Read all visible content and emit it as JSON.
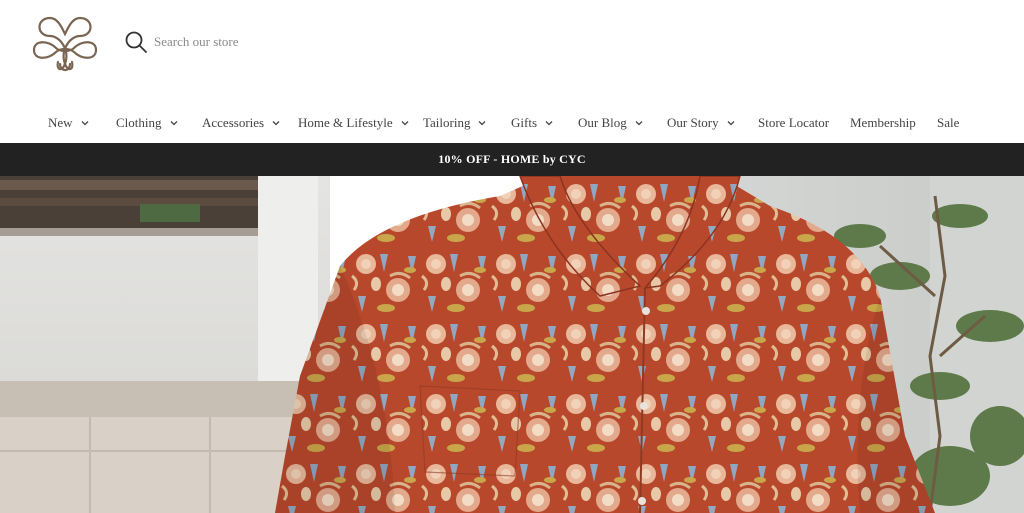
{
  "search": {
    "placeholder": "Search our store"
  },
  "nav": {
    "items": [
      {
        "label": "New",
        "has_dropdown": true
      },
      {
        "label": "Clothing",
        "has_dropdown": true
      },
      {
        "label": "Accessories",
        "has_dropdown": true
      },
      {
        "label": "Home & Lifestyle",
        "has_dropdown": true
      },
      {
        "label": "Tailoring",
        "has_dropdown": true
      },
      {
        "label": "Gifts",
        "has_dropdown": true
      },
      {
        "label": "Our Blog",
        "has_dropdown": true
      },
      {
        "label": "Our Story",
        "has_dropdown": true
      },
      {
        "label": "Store Locator",
        "has_dropdown": false
      },
      {
        "label": "Membership",
        "has_dropdown": false
      },
      {
        "label": "Sale",
        "has_dropdown": false
      }
    ]
  },
  "promo": {
    "text": "10% OFF - HOME by CYC"
  },
  "colors": {
    "brand_logo": "#7a6552",
    "promo_bg": "#222222",
    "shirt": "#b8482c"
  },
  "icons": {
    "logo": "knot-logo-icon",
    "search": "search-icon",
    "dropdown": "chevron-down-icon"
  }
}
